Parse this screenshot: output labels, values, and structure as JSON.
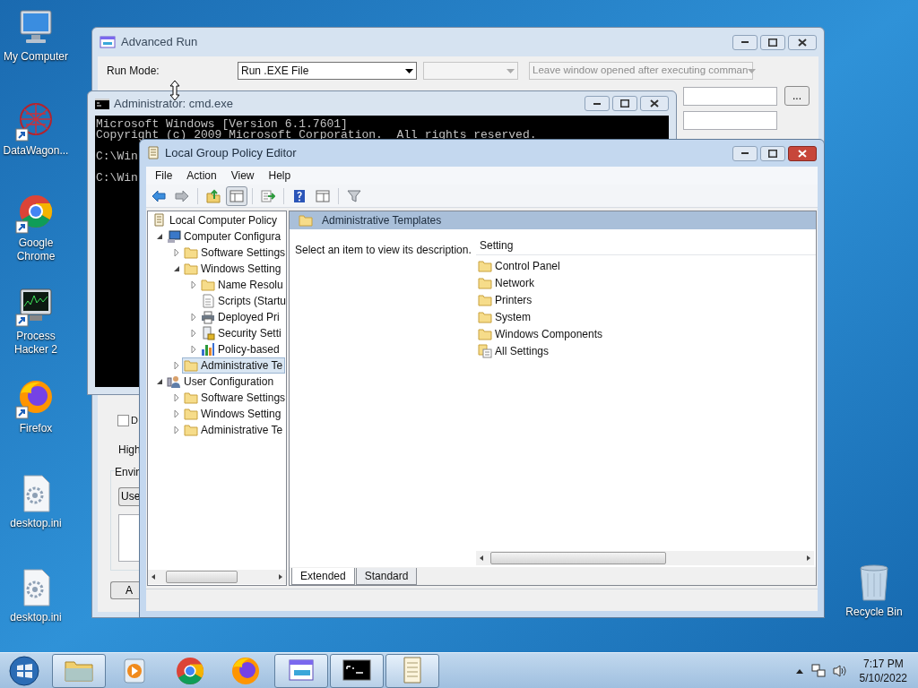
{
  "desktop_icons": [
    {
      "label": "My Computer",
      "kind": "computer",
      "shortcut": false
    },
    {
      "label": "DataWagon...",
      "kind": "sphere",
      "shortcut": true
    },
    {
      "label": "Google Chrome",
      "kind": "chrome",
      "shortcut": true
    },
    {
      "label": "Process Hacker 2",
      "kind": "hacker",
      "shortcut": true
    },
    {
      "label": "Firefox",
      "kind": "firefox",
      "shortcut": true
    },
    {
      "label": "desktop.ini",
      "kind": "ini",
      "shortcut": false
    },
    {
      "label": "desktop.ini",
      "kind": "ini",
      "shortcut": false
    },
    {
      "label": "Recycle Bin",
      "kind": "bin",
      "shortcut": false
    }
  ],
  "advanced_run": {
    "title": "Advanced Run",
    "run_mode_label": "Run Mode:",
    "run_mode": "Run .EXE File",
    "option": "Leave window opened after executing comman",
    "browse_button": "...",
    "checkbox": {
      "label": "D",
      "checked": false
    },
    "priority_label": "High",
    "environment_label": "Envir",
    "environment_button": "Use",
    "bottom_button": "A"
  },
  "cmd": {
    "title": "Administrator: cmd.exe",
    "lines": [
      "Microsoft Windows [Version 6.1.7601]",
      "Copyright (c) 2009 Microsoft Corporation.  All rights reserved.",
      "C:\\Win",
      "C:\\Win"
    ]
  },
  "gpe": {
    "title": "Local Group Policy Editor",
    "menu": [
      "File",
      "Action",
      "View",
      "Help"
    ],
    "toolbar": [
      {
        "kind": "back",
        "pressed": false
      },
      {
        "kind": "forward",
        "pressed": false
      },
      {
        "kind": "up",
        "pressed": false
      },
      {
        "kind": "tree",
        "pressed": true
      },
      {
        "kind": "export",
        "pressed": false
      },
      {
        "kind": "help",
        "pressed": false
      },
      {
        "kind": "pane",
        "pressed": false
      },
      {
        "kind": "filter",
        "pressed": false
      }
    ],
    "tree": [
      {
        "label": "Local Computer Policy",
        "kind": "policy",
        "selected": false,
        "children": [
          {
            "label": "Computer Configura",
            "kind": "computer",
            "expanded": true,
            "selected": false,
            "children": [
              {
                "label": "Software Settings",
                "kind": "folder",
                "expanded": false,
                "selected": false
              },
              {
                "label": "Windows Setting",
                "kind": "folder",
                "expanded": true,
                "selected": false,
                "children": [
                  {
                    "label": "Name Resolu",
                    "kind": "folder",
                    "expanded": false,
                    "selected": false
                  },
                  {
                    "label": "Scripts (Startu",
                    "kind": "script",
                    "selected": false
                  },
                  {
                    "label": "Deployed Pri",
                    "kind": "printer",
                    "expanded": false,
                    "selected": false
                  },
                  {
                    "label": "Security Setti",
                    "kind": "security",
                    "expanded": false,
                    "selected": false
                  },
                  {
                    "label": "Policy-based",
                    "kind": "chart",
                    "expanded": false,
                    "selected": false
                  }
                ]
              },
              {
                "label": "Administrative Te",
                "kind": "folder",
                "expanded": false,
                "selected": true
              }
            ]
          },
          {
            "label": "User Configuration",
            "kind": "user",
            "expanded": true,
            "selected": false,
            "children": [
              {
                "label": "Software Settings",
                "kind": "folder",
                "expanded": false,
                "selected": false
              },
              {
                "label": "Windows Setting",
                "kind": "folder",
                "expanded": false,
                "selected": false
              },
              {
                "label": "Administrative Te",
                "kind": "folder",
                "expanded": false,
                "selected": false
              }
            ]
          }
        ]
      }
    ],
    "header": "Administrative Templates",
    "description": "Select an item to view its description.",
    "column": "Setting",
    "items": [
      {
        "label": "Control Panel",
        "kind": "folder"
      },
      {
        "label": "Network",
        "kind": "folder"
      },
      {
        "label": "Printers",
        "kind": "folder"
      },
      {
        "label": "System",
        "kind": "folder"
      },
      {
        "label": "Windows Components",
        "kind": "folder"
      },
      {
        "label": "All Settings",
        "kind": "settings"
      }
    ],
    "tabs": [
      {
        "label": "Extended",
        "selected": true
      },
      {
        "label": "Standard",
        "selected": false
      }
    ]
  },
  "taskbar": {
    "apps": [
      {
        "kind": "explorer",
        "running": true
      },
      {
        "kind": "media",
        "running": false
      },
      {
        "kind": "chrome",
        "running": false
      },
      {
        "kind": "firefox",
        "running": false
      },
      {
        "kind": "advrun",
        "running": true
      },
      {
        "kind": "cmd",
        "running": true
      },
      {
        "kind": "notepad",
        "running": true
      }
    ],
    "time": "7:17 PM",
    "date": "5/10/2022"
  }
}
